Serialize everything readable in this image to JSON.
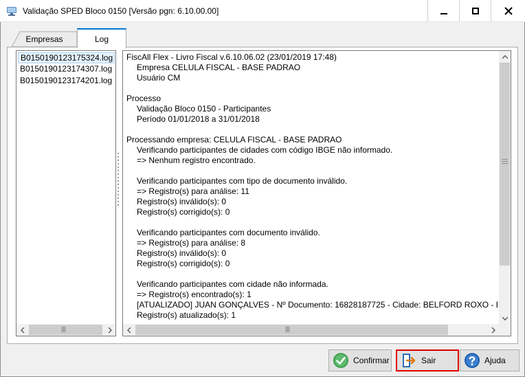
{
  "window": {
    "title": "Validação SPED Bloco 0150 [Versão pgn: 6.10.00.00]",
    "controls": {
      "minimize": "minimize",
      "maximize": "maximize",
      "close": "close"
    }
  },
  "tabs": [
    {
      "label": "Empresas",
      "active": false
    },
    {
      "label": "Log",
      "active": true
    }
  ],
  "log_files": [
    {
      "name": "B0150190123175324.log",
      "selected": true
    },
    {
      "name": "B0150190123174307.log",
      "selected": false
    },
    {
      "name": "B0150190123174201.log",
      "selected": false
    }
  ],
  "log_lines": [
    {
      "text": "FiscAll Flex - Livro Fiscal v.6.10.06.02 (23/01/2019 17:48)",
      "indent": false
    },
    {
      "text": "Empresa CELULA FISCAL - BASE PADRAO",
      "indent": true
    },
    {
      "text": "Usuário CM",
      "indent": true
    },
    {
      "text": "",
      "indent": false
    },
    {
      "text": "Processo",
      "indent": false
    },
    {
      "text": "Validação Bloco 0150 - Participantes",
      "indent": true
    },
    {
      "text": "Período 01/01/2018 a 31/01/2018",
      "indent": true
    },
    {
      "text": "",
      "indent": false
    },
    {
      "text": "Processando empresa: CELULA FISCAL - BASE PADRAO",
      "indent": false
    },
    {
      "text": "Verificando participantes de cidades com código IBGE não informado.",
      "indent": true
    },
    {
      "text": "=> Nenhum registro encontrado.",
      "indent": true
    },
    {
      "text": "",
      "indent": false
    },
    {
      "text": "Verificando participantes com tipo de documento inválido.",
      "indent": true
    },
    {
      "text": "=> Registro(s) para análise: 11",
      "indent": true
    },
    {
      "text": "Registro(s) inválido(s): 0",
      "indent": true
    },
    {
      "text": "Registro(s) corrigido(s): 0",
      "indent": true
    },
    {
      "text": "",
      "indent": false
    },
    {
      "text": "Verificando participantes com documento inválido.",
      "indent": true
    },
    {
      "text": "=> Registro(s) para análise: 8",
      "indent": true
    },
    {
      "text": "Registro(s) inválido(s): 0",
      "indent": true
    },
    {
      "text": "Registro(s) corrigido(s): 0",
      "indent": true
    },
    {
      "text": "",
      "indent": false
    },
    {
      "text": "Verificando participantes com cidade não informada.",
      "indent": true
    },
    {
      "text": "=> Registro(s) encontrado(s): 1",
      "indent": true
    },
    {
      "text": "[ATUALIZADO] JUAN GONÇALVES - Nº Documento: 16828187725 - Cidade: BELFORD ROXO - Estado",
      "indent": true
    },
    {
      "text": "Registro(s) atualizado(s): 1",
      "indent": true
    }
  ],
  "buttons": {
    "confirmar": {
      "label": "Confirmar",
      "icon": "check-icon"
    },
    "sair": {
      "label": "Sair",
      "icon": "exit-icon"
    },
    "ajuda": {
      "label": "Ajuda",
      "icon": "help-icon"
    }
  },
  "colors": {
    "accent": "#0078d7",
    "highlight": "#e00000",
    "selection": "#e5f3ff"
  }
}
